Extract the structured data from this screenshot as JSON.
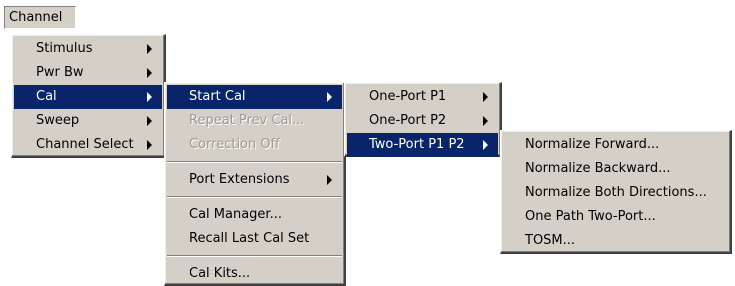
{
  "menubar": {
    "channel": "Channel"
  },
  "channel_menu": {
    "items": [
      "Stimulus",
      "Pwr Bw",
      "Cal",
      "Sweep",
      "Channel Select"
    ]
  },
  "cal_menu": {
    "start_cal": "Start Cal",
    "repeat_prev_cal": "Repeat Prev Cal...",
    "correction_off": "Correction Off",
    "port_extensions": "Port Extensions",
    "cal_manager": "Cal Manager...",
    "recall_last_cal_set": "Recall Last Cal Set",
    "cal_kits": "Cal Kits..."
  },
  "start_cal_menu": {
    "items": [
      "One-Port P1",
      "One-Port P2",
      "Two-Port P1 P2"
    ]
  },
  "two_port_menu": {
    "items": [
      "Normalize Forward...",
      "Normalize Backward...",
      "Normalize Both Directions...",
      "One Path Two-Port...",
      "TOSM..."
    ]
  },
  "colors": {
    "menu_bg": "#d4d0c8",
    "highlight": "#0a246a",
    "disabled_text": "#9d9a92"
  }
}
